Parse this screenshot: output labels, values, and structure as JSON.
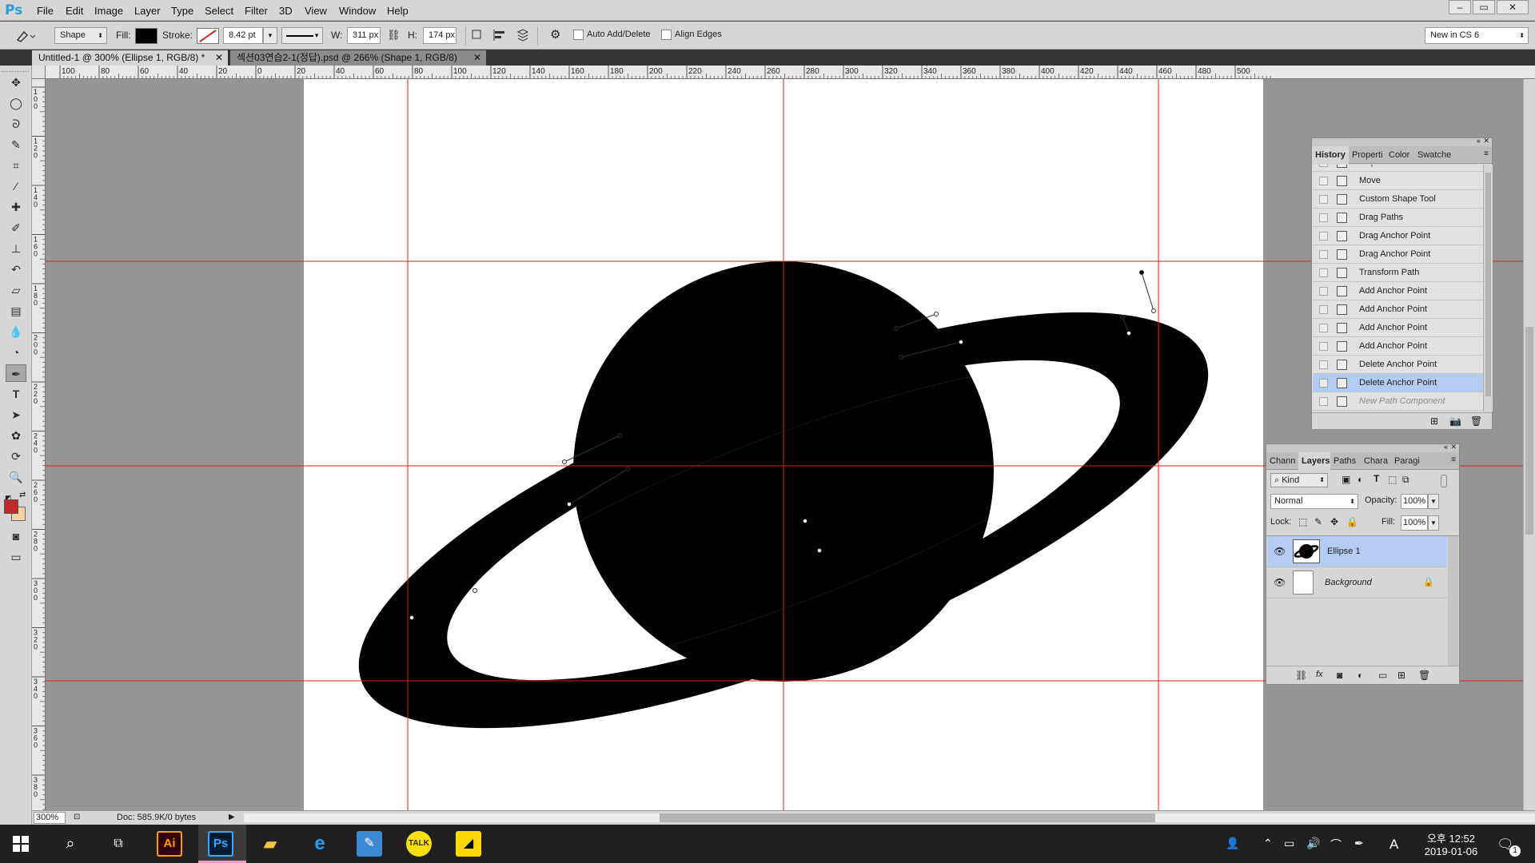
{
  "menubar": {
    "logo": "Ps",
    "items": [
      "File",
      "Edit",
      "Image",
      "Layer",
      "Type",
      "Select",
      "Filter",
      "3D",
      "View",
      "Window",
      "Help"
    ],
    "window_buttons": [
      "–",
      "▭",
      "✕"
    ]
  },
  "options": {
    "mode": "Shape",
    "fill_label": "Fill:",
    "stroke_label": "Stroke:",
    "stroke_width": "8.42 pt",
    "w_label": "W:",
    "w_value": "311 px",
    "h_label": "H:",
    "h_value": "174 px",
    "auto_add_delete": "Auto Add/Delete",
    "align_edges": "Align Edges",
    "workspace": "New in CS 6"
  },
  "tabs": [
    {
      "label": "Untitled-1 @ 300% (Ellipse 1, RGB/8) *",
      "active": true
    },
    {
      "label": "섹션03연습2-1(정답).psd @ 266% (Shape 1, RGB/8)",
      "active": false
    }
  ],
  "ruler": {
    "h_labels": [
      "100",
      "80",
      "60",
      "40",
      "20",
      "0",
      "20",
      "40",
      "60",
      "80",
      "100",
      "120",
      "140",
      "160",
      "180",
      "200",
      "220",
      "240",
      "260",
      "280",
      "300",
      "320",
      "340",
      "360",
      "380",
      "400",
      "420",
      "440",
      "460",
      "480",
      "500"
    ],
    "v_labels": [
      "1",
      "0",
      "0",
      "1",
      "2",
      "0",
      "1",
      "4",
      "0",
      "1",
      "6",
      "0",
      "1",
      "8",
      "0",
      "2",
      "0",
      "0",
      "2",
      "2",
      "0",
      "2",
      "4",
      "0",
      "2",
      "6",
      "0",
      "2",
      "8",
      "0",
      "3",
      "0",
      "0",
      "3",
      "2",
      "0",
      "3",
      "4",
      "0",
      "3",
      "6",
      "0",
      "3",
      "8",
      "0",
      "4",
      "0",
      "0"
    ]
  },
  "status": {
    "zoom": "300%",
    "doc": "Doc: 585.9K/0 bytes"
  },
  "history": {
    "tabs": [
      "History",
      "Properti",
      "Color",
      "Swatche"
    ],
    "items": [
      {
        "label": "Ellipse Tool",
        "state": "partial"
      },
      {
        "label": "Move",
        "state": "normal"
      },
      {
        "label": "Custom Shape Tool",
        "state": "normal"
      },
      {
        "label": "Drag Paths",
        "state": "normal"
      },
      {
        "label": "Drag Anchor Point",
        "state": "normal"
      },
      {
        "label": "Drag Anchor Point",
        "state": "normal"
      },
      {
        "label": "Transform Path",
        "state": "normal"
      },
      {
        "label": "Add Anchor Point",
        "state": "normal"
      },
      {
        "label": "Add Anchor Point",
        "state": "normal"
      },
      {
        "label": "Add Anchor Point",
        "state": "normal"
      },
      {
        "label": "Add Anchor Point",
        "state": "normal"
      },
      {
        "label": "Delete Anchor Point",
        "state": "normal"
      },
      {
        "label": "Delete Anchor Point",
        "state": "selected"
      },
      {
        "label": "New Path Component",
        "state": "future"
      }
    ]
  },
  "layers": {
    "tabs": [
      "Chann",
      "Layers",
      "Paths",
      "Chara",
      "Paragi"
    ],
    "kind": "Kind",
    "blend": "Normal",
    "opacity_label": "Opacity:",
    "opacity": "100%",
    "lock_label": "Lock:",
    "fill_label": "Fill:",
    "fill": "100%",
    "items": [
      {
        "name": "Ellipse 1",
        "selected": true,
        "italic": false
      },
      {
        "name": "Background",
        "selected": false,
        "italic": true
      }
    ]
  },
  "taskbar": {
    "apps": [
      "Ai",
      "Ps"
    ],
    "time": "오후 12:52",
    "date": "2019-01-06",
    "notification_count": "1",
    "ime": "A"
  },
  "colors": {
    "accent": "#26a0da",
    "guide": "#e0201e",
    "selection": "#b4ccf4",
    "foreground": "#c0292a",
    "background_swatch": "#f4d3a1"
  }
}
